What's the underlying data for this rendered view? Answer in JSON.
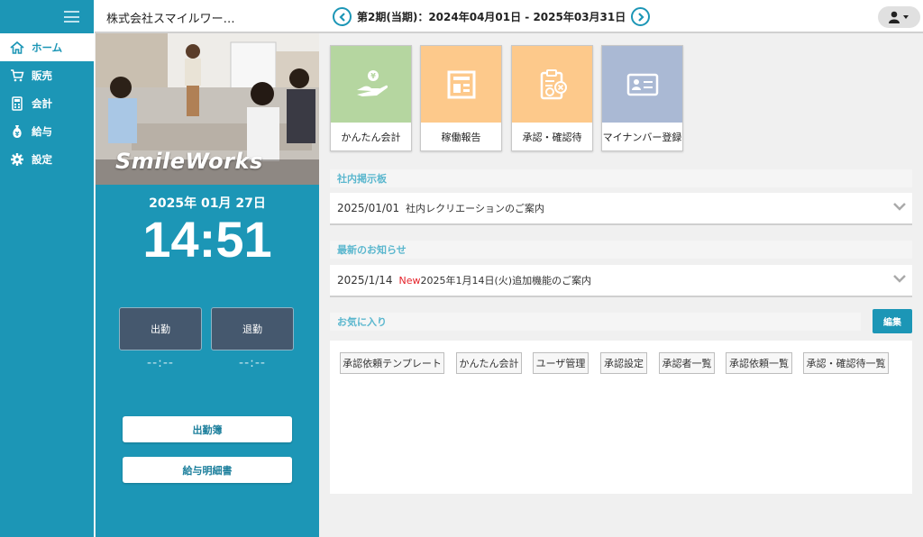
{
  "sidebar": {
    "items": [
      {
        "label": "ホーム",
        "icon": "home-icon"
      },
      {
        "label": "販売",
        "icon": "cart-icon"
      },
      {
        "label": "会計",
        "icon": "calculator-icon"
      },
      {
        "label": "給与",
        "icon": "money-bag-icon"
      },
      {
        "label": "設定",
        "icon": "gear-icon"
      }
    ]
  },
  "header": {
    "company": "株式会社スマイルワー…",
    "period": "第2期(当期)：2024年04月01日 - 2025年03月31日"
  },
  "hero": {
    "logo_text": "SmileWorks"
  },
  "clock": {
    "date": "2025年 01月 27日",
    "time": "14:51"
  },
  "attendance": {
    "clock_in_label": "出勤",
    "clock_out_label": "退勤",
    "clock_in_time": "--:--",
    "clock_out_time": "--:--",
    "attendance_book": "出勤簿",
    "payslip": "給与明細書"
  },
  "tiles": [
    {
      "label": "かんたん会計",
      "color": "#b5d6a0",
      "icon": "hand-coin-icon"
    },
    {
      "label": "稼働報告",
      "color": "#fdc98b",
      "icon": "report-icon"
    },
    {
      "label": "承認・確認待",
      "color": "#fdc98b",
      "icon": "approval-clipboard-icon"
    },
    {
      "label": "マイナンバー登録",
      "color": "#aab9d4",
      "icon": "id-card-icon"
    }
  ],
  "bulletin": {
    "title": "社内掲示板",
    "item": {
      "date": "2025/01/01",
      "text": "社内レクリエーションのご案内"
    }
  },
  "news": {
    "title": "最新のお知らせ",
    "item": {
      "date": "2025/1/14",
      "badge": "New",
      "text": "2025年1月14日(火)追加機能のご案内"
    }
  },
  "favorites": {
    "title": "お気に入り",
    "edit_label": "編集",
    "items": [
      "承認依頼テンプレート",
      "かんたん会計",
      "ユーザ管理",
      "承認設定",
      "承認者一覧",
      "承認依頼一覧",
      "承認・確認待一覧"
    ]
  }
}
